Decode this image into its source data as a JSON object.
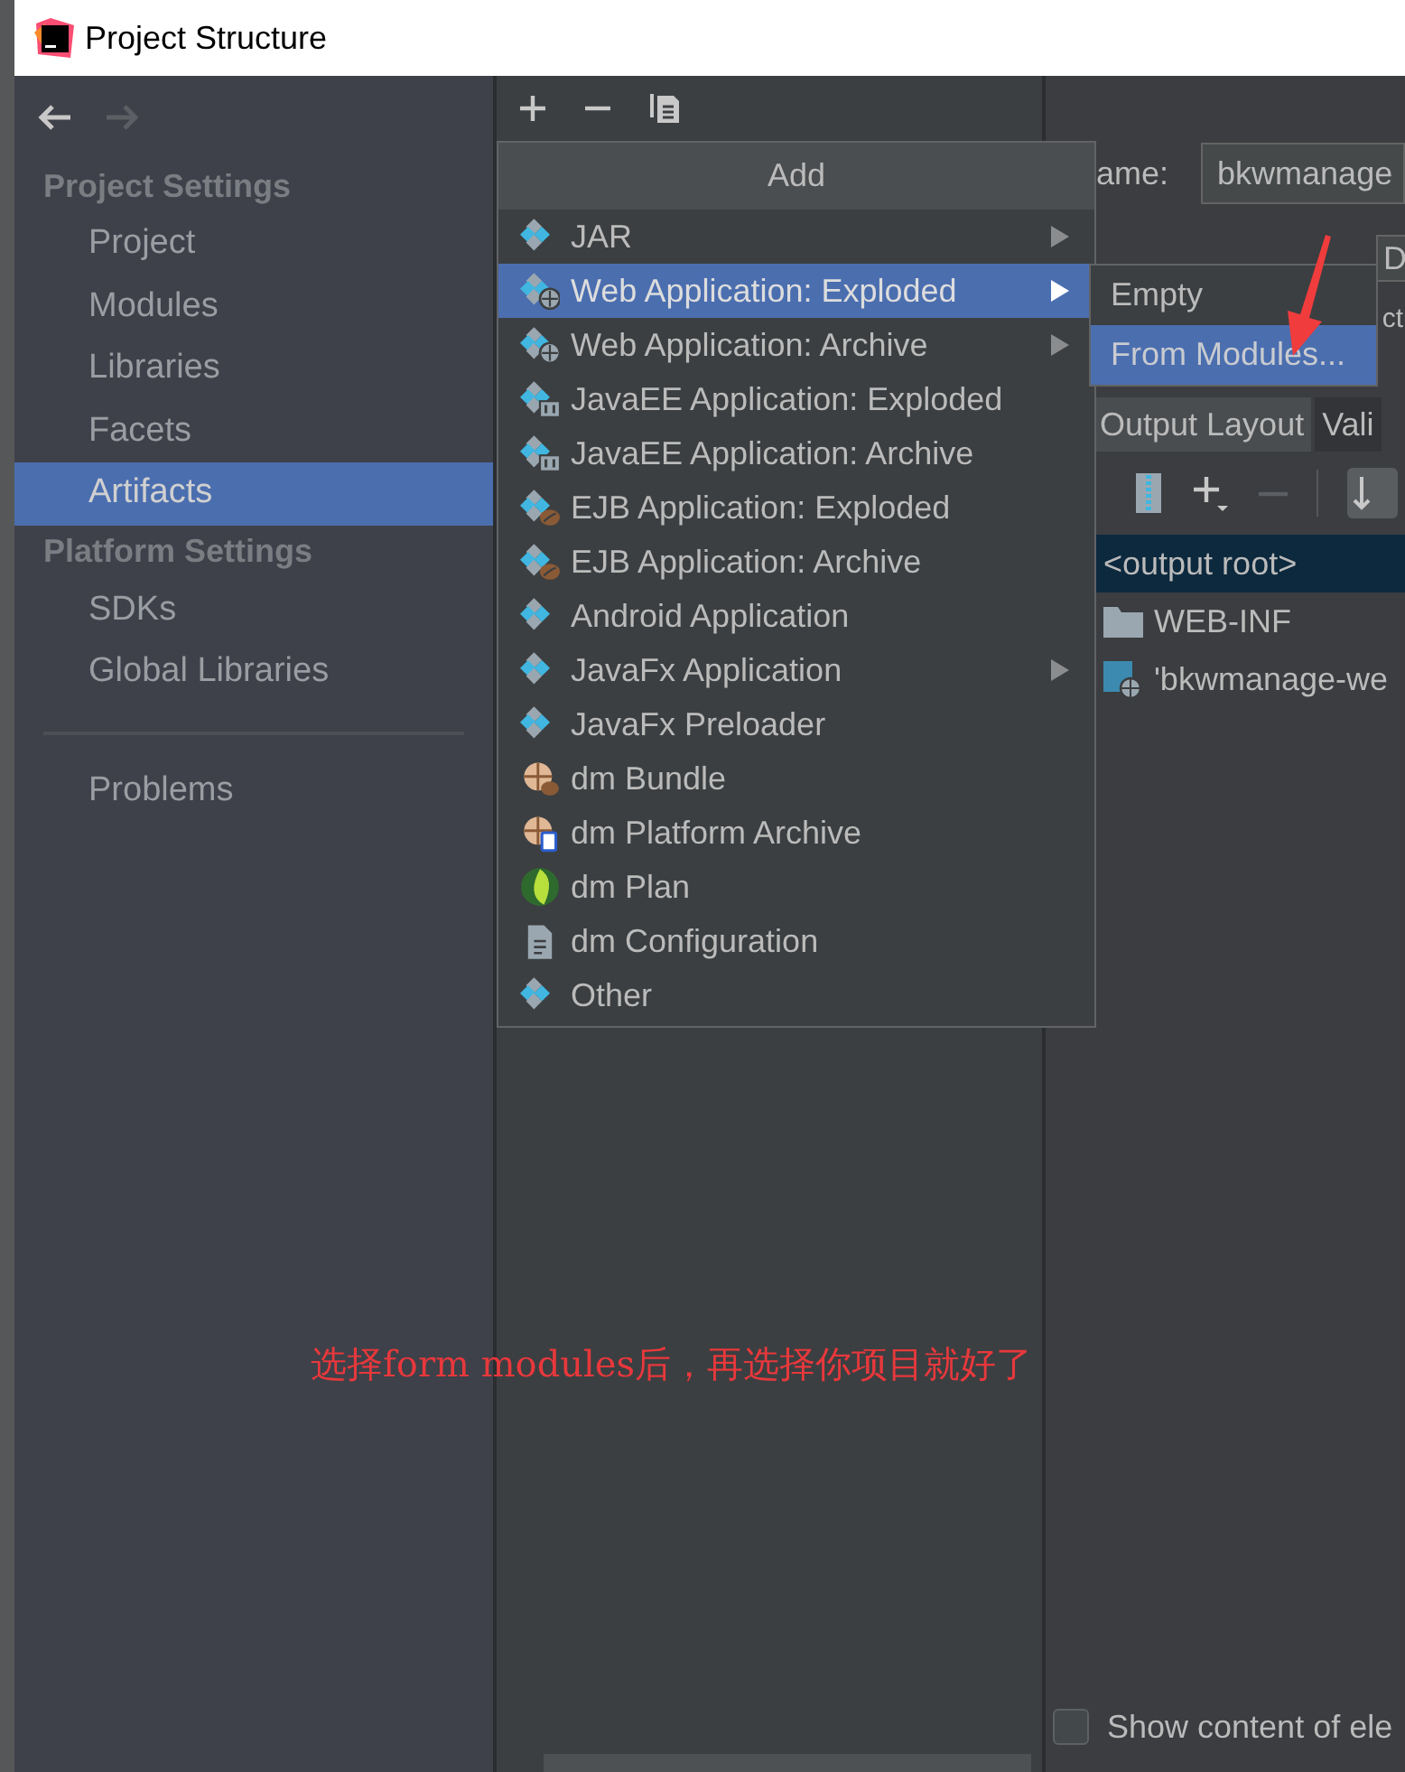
{
  "window": {
    "title": "Project Structure"
  },
  "sidebar": {
    "sections": [
      {
        "heading": "Project Settings",
        "items": [
          {
            "label": "Project",
            "selected": false
          },
          {
            "label": "Modules",
            "selected": false
          },
          {
            "label": "Libraries",
            "selected": false
          },
          {
            "label": "Facets",
            "selected": false
          },
          {
            "label": "Artifacts",
            "selected": true
          }
        ]
      },
      {
        "heading": "Platform Settings",
        "items": [
          {
            "label": "SDKs",
            "selected": false
          },
          {
            "label": "Global Libraries",
            "selected": false
          }
        ]
      }
    ],
    "footer_items": [
      {
        "label": "Problems",
        "selected": false
      }
    ]
  },
  "add_menu": {
    "title": "Add",
    "items": [
      {
        "label": "JAR",
        "kind": "diamond",
        "has_submenu": true,
        "selected": false
      },
      {
        "label": "Web Application: Exploded",
        "kind": "web",
        "has_submenu": true,
        "selected": true
      },
      {
        "label": "Web Application: Archive",
        "kind": "web",
        "has_submenu": true,
        "selected": false
      },
      {
        "label": "JavaEE Application: Exploded",
        "kind": "javaee",
        "has_submenu": false,
        "selected": false
      },
      {
        "label": "JavaEE Application: Archive",
        "kind": "javaee",
        "has_submenu": false,
        "selected": false
      },
      {
        "label": "EJB Application: Exploded",
        "kind": "ejb",
        "has_submenu": false,
        "selected": false
      },
      {
        "label": "EJB Application: Archive",
        "kind": "ejb",
        "has_submenu": false,
        "selected": false
      },
      {
        "label": "Android Application",
        "kind": "diamond",
        "has_submenu": false,
        "selected": false
      },
      {
        "label": "JavaFx Application",
        "kind": "diamond",
        "has_submenu": true,
        "selected": false
      },
      {
        "label": "JavaFx Preloader",
        "kind": "diamond",
        "has_submenu": false,
        "selected": false
      },
      {
        "label": "dm Bundle",
        "kind": "bundle",
        "has_submenu": false,
        "selected": false
      },
      {
        "label": "dm Platform Archive",
        "kind": "platform",
        "has_submenu": false,
        "selected": false
      },
      {
        "label": "dm Plan",
        "kind": "plan",
        "has_submenu": false,
        "selected": false
      },
      {
        "label": "dm Configuration",
        "kind": "config",
        "has_submenu": false,
        "selected": false
      },
      {
        "label": "Other",
        "kind": "diamond",
        "has_submenu": false,
        "selected": false
      }
    ]
  },
  "submenu": {
    "items": [
      {
        "label": "Empty",
        "selected": false
      },
      {
        "label": "From Modules...",
        "selected": true
      }
    ]
  },
  "artifact_editor": {
    "name_label": "ame:",
    "name_value": "bkwmanage",
    "field_2_value": "D",
    "label_3": "ct",
    "tabs": [
      {
        "label": "Output Layout",
        "selected": true
      },
      {
        "label": "Vali",
        "selected": false
      }
    ],
    "tree": [
      {
        "label": "<output root>",
        "kind": "root",
        "selected": true
      },
      {
        "label": "WEB-INF",
        "kind": "folder",
        "selected": false
      },
      {
        "label": "'bkwmanage-we",
        "kind": "module",
        "selected": false
      }
    ],
    "show_content": {
      "label": "Show content of ele",
      "checked": false
    }
  },
  "annotation": {
    "text": "选择form modules后，再选择你项目就好了"
  }
}
